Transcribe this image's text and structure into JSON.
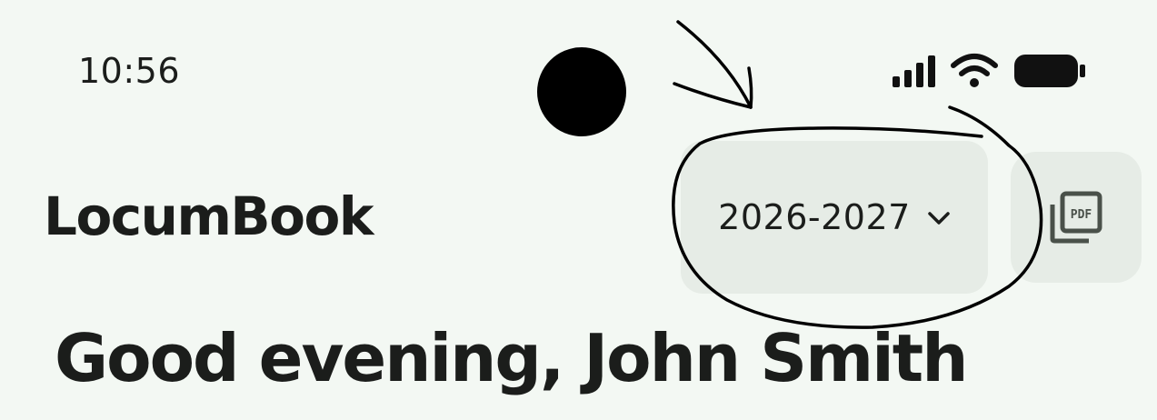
{
  "status_bar": {
    "time": "10:56",
    "icons": [
      "signal-icon",
      "wifi-icon",
      "battery-icon"
    ]
  },
  "app_bar": {
    "title": "LocumBook",
    "year_selector": {
      "label": "2026-2027",
      "icon": "chevron-down-icon"
    },
    "export_button": {
      "icon": "picture-as-pdf-icon",
      "icon_text": "PDF"
    }
  },
  "main": {
    "greeting": "Good evening, John Smith"
  },
  "colors": {
    "background": "#f3f8f3",
    "surface": "#e6ece6",
    "text": "#1b1d1b",
    "icon": "#4a514a"
  }
}
